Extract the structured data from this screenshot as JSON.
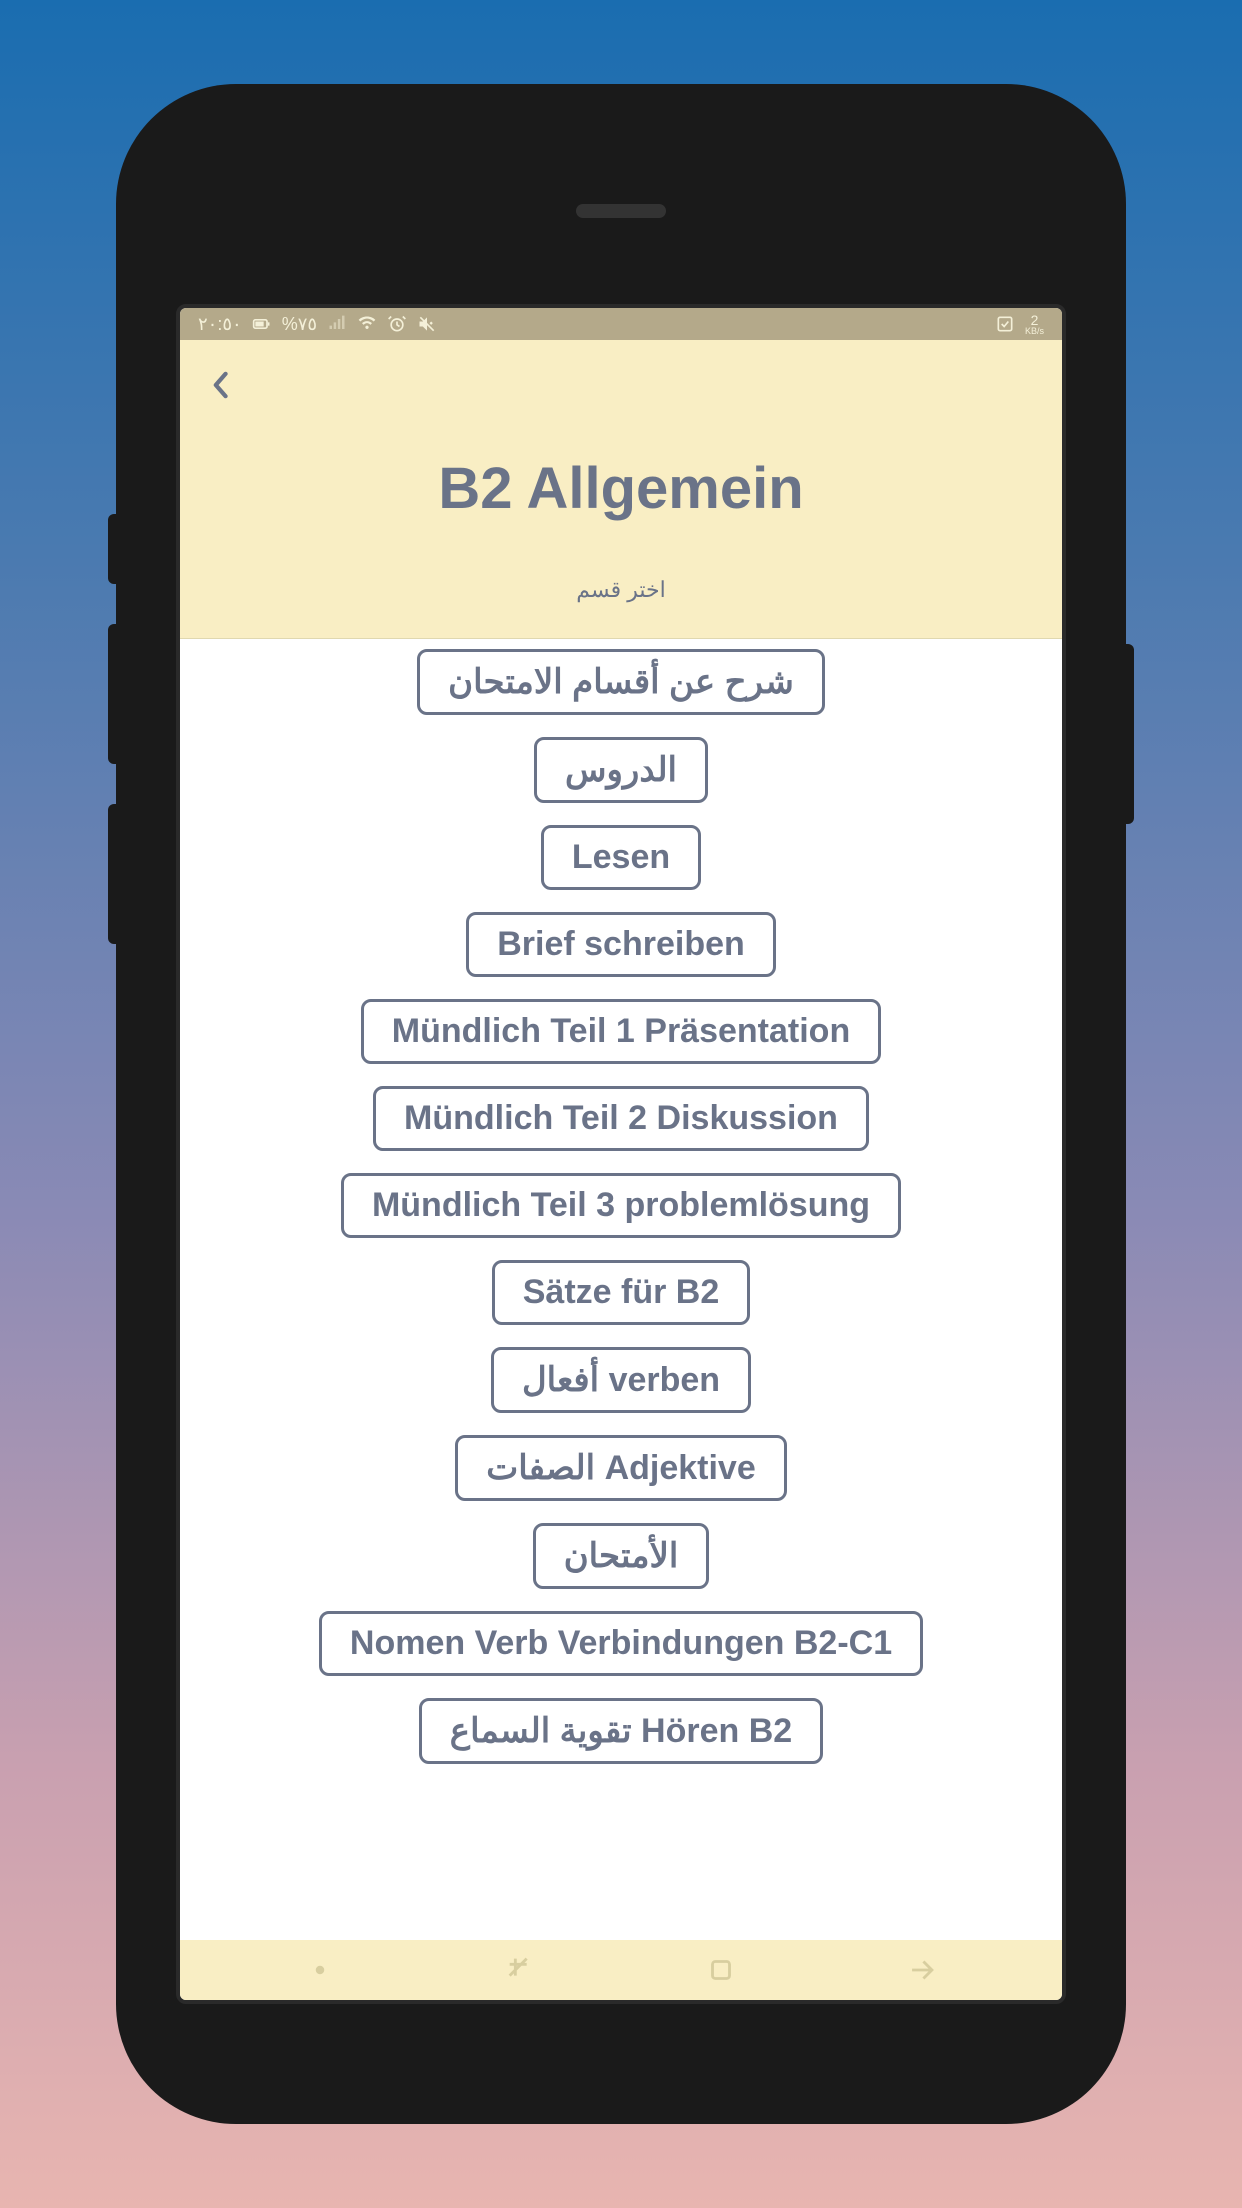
{
  "status_bar": {
    "time": "٢٠:٥٠",
    "battery": "%٧٥",
    "speed": "2",
    "speed_unit": "KB/s"
  },
  "header": {
    "title": "B2 Allgemein",
    "subtitle": "اختر قسم"
  },
  "menu": {
    "items": [
      "شرح عن أقسام الامتحان",
      "الدروس",
      "Lesen",
      "Brief schreiben",
      "Mündlich Teil 1 Präsentation",
      "Mündlich Teil 2 Diskussion",
      "Mündlich Teil 3 problemlösung",
      "Sätze für B2",
      "verben أفعال",
      "Adjektive الصفات",
      "الأمتحان",
      "Nomen Verb Verbindungen B2-C1",
      "Hören B2  تقوية السماع"
    ]
  }
}
